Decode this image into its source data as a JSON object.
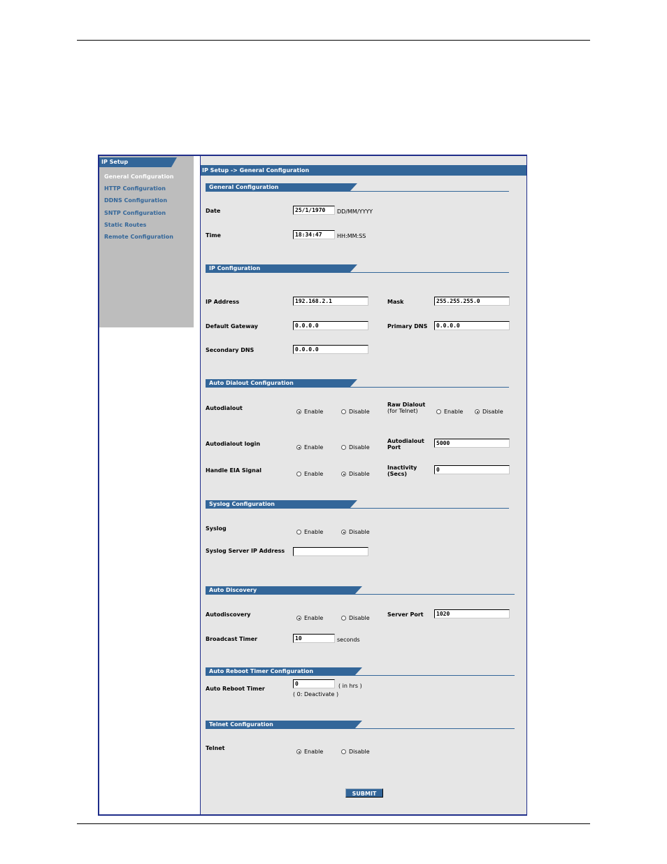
{
  "sidebar": {
    "header": "IP Setup",
    "items": [
      {
        "label": "General Configuration"
      },
      {
        "label": "HTTP Configuration"
      },
      {
        "label": "DDNS Configuration"
      },
      {
        "label": "SNTP Configuration"
      },
      {
        "label": "Static Routes"
      },
      {
        "label": "Remote Configuration"
      }
    ]
  },
  "breadcrumb": "IP Setup -> General Configuration",
  "general": {
    "title": "General Configuration",
    "date_label": "Date",
    "date_value": "25/1/1970",
    "date_format": "DD/MM/YYYY",
    "time_label": "Time",
    "time_value": "18:34:47",
    "time_format": "HH:MM:SS"
  },
  "ip": {
    "title": "IP Configuration",
    "ip_label": "IP Address",
    "ip_value": "192.168.2.1",
    "mask_label": "Mask",
    "mask_value": "255.255.255.0",
    "gw_label": "Default Gateway",
    "gw_value": "0.0.0.0",
    "pdns_label": "Primary DNS",
    "pdns_value": "0.0.0.0",
    "sdns_label": "Secondary DNS",
    "sdns_value": "0.0.0.0"
  },
  "dialout": {
    "title": "Auto Dialout Configuration",
    "autodialout_label": "Autodialout",
    "raw_label_1": "Raw Dialout",
    "raw_label_2": "(for Telnet)",
    "login_label": "Autodialout login",
    "port_label_1": "Autodialout",
    "port_label_2": "Port",
    "port_value": "5000",
    "eia_label": "Handle EIA Signal",
    "inactivity_label_1": "Inactivity",
    "inactivity_label_2": "(Secs)",
    "inactivity_value": "0"
  },
  "syslog": {
    "title": "Syslog Configuration",
    "syslog_label": "Syslog",
    "server_label": "Syslog Server IP Address",
    "server_value": ""
  },
  "discovery": {
    "title": "Auto Discovery",
    "label": "Autodiscovery",
    "server_port_label": "Server Port",
    "server_port_value": "1020",
    "broadcast_label": "Broadcast Timer",
    "broadcast_value": "10",
    "broadcast_unit": "seconds"
  },
  "reboot": {
    "title": "Auto Reboot Timer Configuration",
    "label": "Auto Reboot Timer",
    "value": "0",
    "unit": "( in hrs )",
    "note": "( 0: Deactivate )"
  },
  "telnet": {
    "title": "Telnet Configuration",
    "label": "Telnet"
  },
  "radio": {
    "enable": "Enable",
    "disable": "Disable"
  },
  "submit_label": "SUBMIT"
}
